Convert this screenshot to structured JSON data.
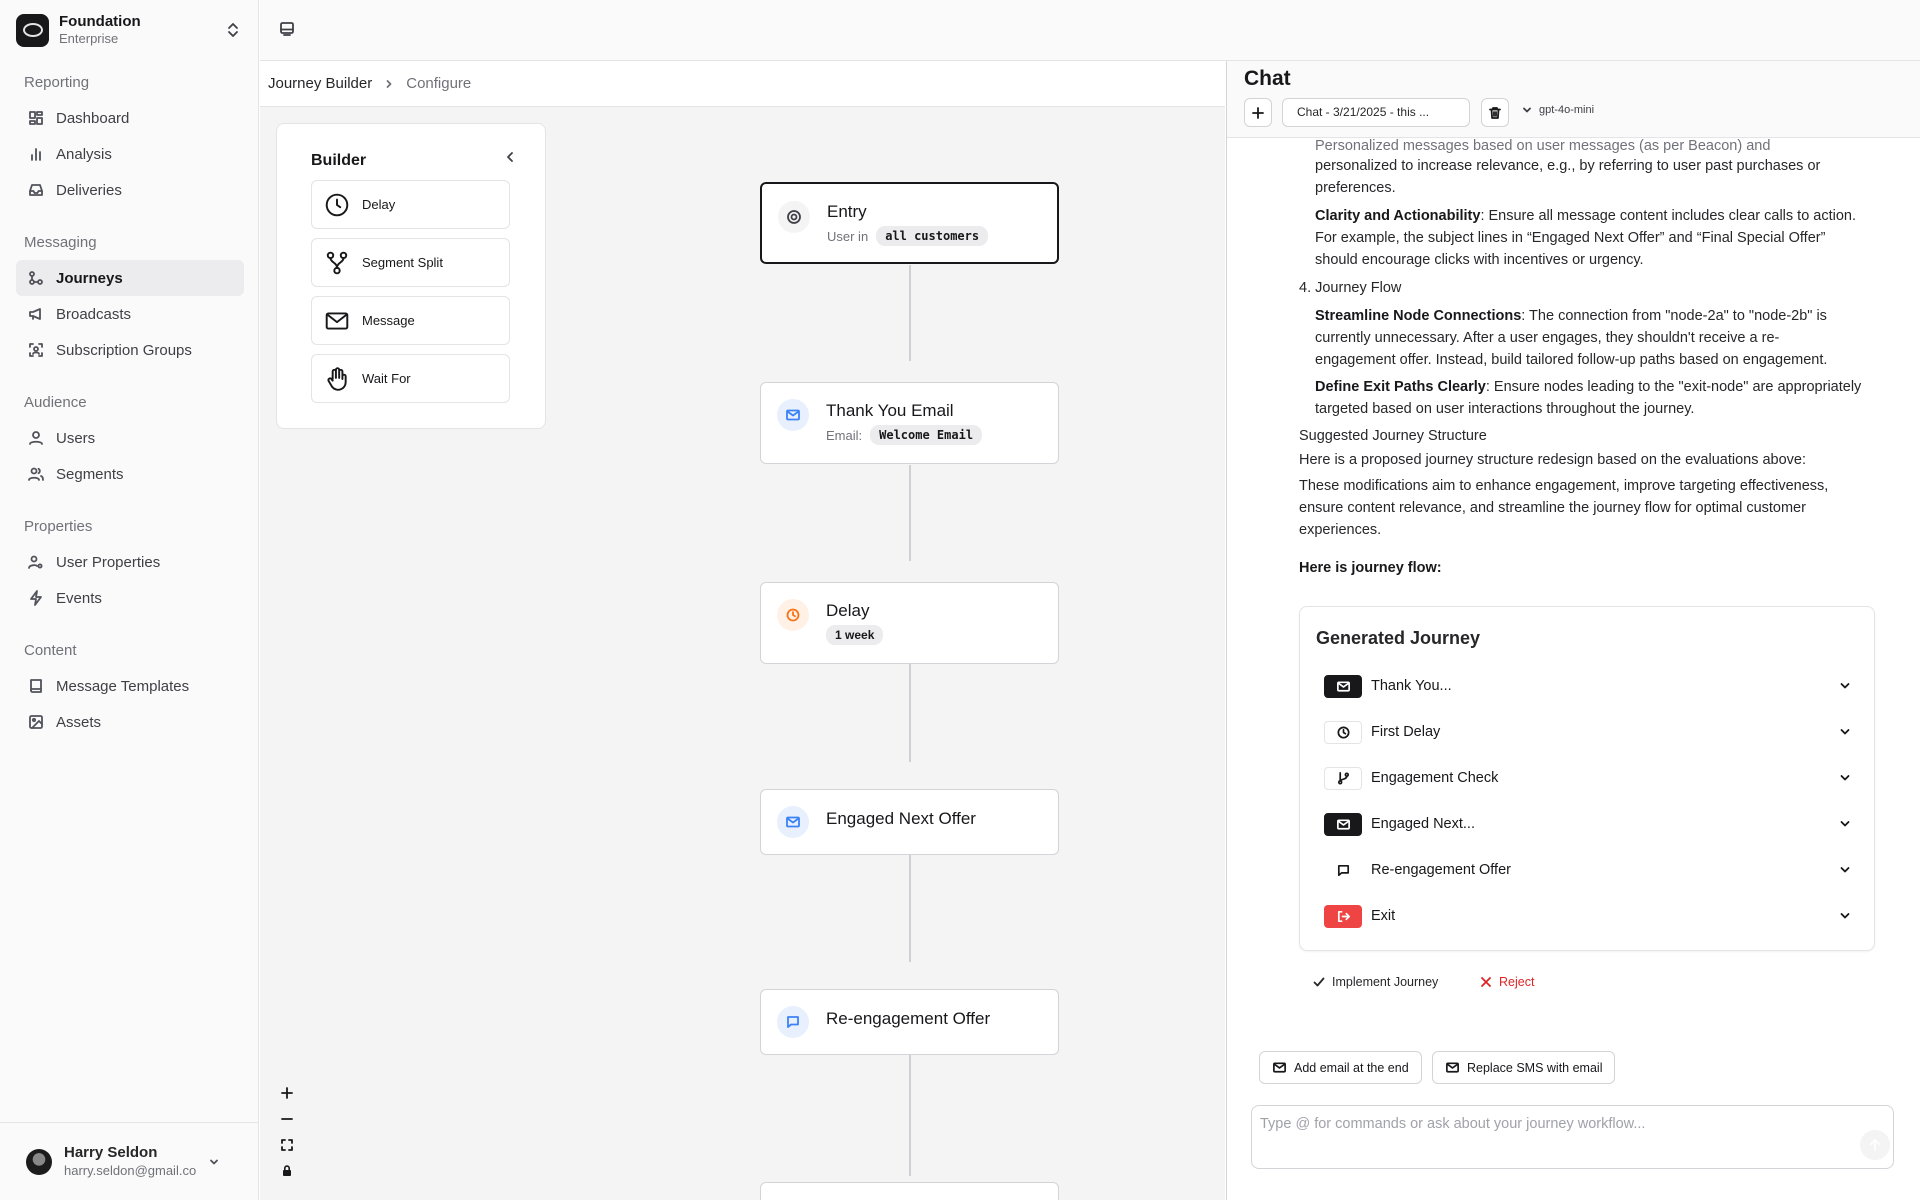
{
  "org": {
    "name": "Foundation",
    "plan": "Enterprise"
  },
  "nav": [
    {
      "label": "Reporting",
      "items": [
        {
          "label": "Dashboard",
          "icon": "layout-dashboard-icon",
          "active": false
        },
        {
          "label": "Analysis",
          "icon": "bar-chart-icon",
          "active": false
        },
        {
          "label": "Deliveries",
          "icon": "inbox-icon",
          "active": false
        }
      ]
    },
    {
      "label": "Messaging",
      "items": [
        {
          "label": "Journeys",
          "icon": "workflow-icon",
          "active": true
        },
        {
          "label": "Broadcasts",
          "icon": "megaphone-icon",
          "active": false
        },
        {
          "label": "Subscription Groups",
          "icon": "scan-users-icon",
          "active": false
        }
      ]
    },
    {
      "label": "Audience",
      "items": [
        {
          "label": "Users",
          "icon": "user-icon",
          "active": false
        },
        {
          "label": "Segments",
          "icon": "users-icon",
          "active": false
        }
      ]
    },
    {
      "label": "Properties",
      "items": [
        {
          "label": "User Properties",
          "icon": "user-cog-icon",
          "active": false
        },
        {
          "label": "Events",
          "icon": "zap-icon",
          "active": false
        }
      ]
    },
    {
      "label": "Content",
      "items": [
        {
          "label": "Message Templates",
          "icon": "book-icon",
          "active": false
        },
        {
          "label": "Assets",
          "icon": "image-icon",
          "active": false
        }
      ]
    }
  ],
  "user": {
    "name": "Harry Seldon",
    "email": "harry.seldon@gmail.co"
  },
  "breadcrumb": {
    "root": "Journey Builder",
    "current": "Configure"
  },
  "builder": {
    "title": "Builder",
    "items": [
      {
        "label": "Delay",
        "icon": "clock-icon"
      },
      {
        "label": "Segment Split",
        "icon": "split-icon"
      },
      {
        "label": "Message",
        "icon": "mail-icon"
      },
      {
        "label": "Wait For",
        "icon": "hand-icon"
      }
    ]
  },
  "nodes": {
    "entry": {
      "title": "Entry",
      "sub_label": "User in",
      "chip": "all customers"
    },
    "thank_you": {
      "title": "Thank You Email",
      "sub_label": "Email:",
      "chip": "Welcome Email"
    },
    "delay": {
      "title": "Delay",
      "chip": "1 week"
    },
    "engaged": {
      "title": "Engaged Next Offer"
    },
    "reengage": {
      "title": "Re-engagement Offer"
    }
  },
  "chat": {
    "title": "Chat",
    "selected_chat": "Chat - 3/21/2025 - this ...",
    "model": "gpt-4o-mini",
    "messages": {
      "p0a": "personalized to increase relevance, e.g., by referring to user past purchases or",
      "p0b": "preferences.",
      "clarity_title": "Clarity and Actionability",
      "clarity_text": ": Ensure all message content includes clear calls to action.",
      "clarity_2": "For example, the subject lines in “Engaged Next Offer” and “Final Special Offer”",
      "clarity_3": "should encourage clicks with incentives or urgency.",
      "flow_heading": "4. Journey Flow",
      "stream_title": "Streamline Node Connections",
      "stream_text": ": The connection from \"node-2a\" to \"node-2b\" is",
      "stream_2": "currently unnecessary. After a user engages, they shouldn't receive a re-",
      "stream_3": "engagement offer. Instead, build tailored follow-up paths based on engagement.",
      "exit_title": "Define Exit Paths Clearly",
      "exit_text": ": Ensure nodes leading to the \"exit-node\" are appropriately",
      "exit_2": "targeted based on user interactions throughout the journey.",
      "suggested_heading": "Suggested Journey Structure",
      "suggested_text": "Here is a proposed journey structure redesign based on the evaluations above:",
      "mods_1": "These modifications aim to enhance engagement, improve targeting effectiveness,",
      "mods_2": "ensure content relevance, and streamline the journey flow for optimal customer",
      "mods_3": "experiences.",
      "flow_label": "Here is journey flow:"
    },
    "generated": {
      "title": "Generated Journey",
      "steps": [
        {
          "label": "Thank You...",
          "icon": "mail-icon"
        },
        {
          "label": "First Delay",
          "icon": "clock-icon"
        },
        {
          "label": "Engagement Check",
          "icon": "git-branch-icon"
        },
        {
          "label": "Engaged Next...",
          "icon": "mail-icon"
        },
        {
          "label": "Re-engagement Offer",
          "icon": "message-square-icon"
        },
        {
          "label": "Exit",
          "icon": "log-out-icon"
        }
      ]
    },
    "actions": {
      "implement": "Implement Journey",
      "reject": "Reject"
    },
    "suggestions": [
      "Add email at the end",
      "Replace SMS with email"
    ],
    "input_placeholder": "Type @ for commands or ask about your journey workflow..."
  },
  "colors": {
    "accent": "#18181b",
    "entry_icon_bg": "#f4f4f5",
    "email_icon": "#3b82f6",
    "email_icon_bg": "#e8f0fe",
    "delay_icon": "#f97316",
    "delay_icon_bg": "#fff1e6",
    "exit_red": "#ef4444",
    "reject_red": "#dc2626"
  }
}
